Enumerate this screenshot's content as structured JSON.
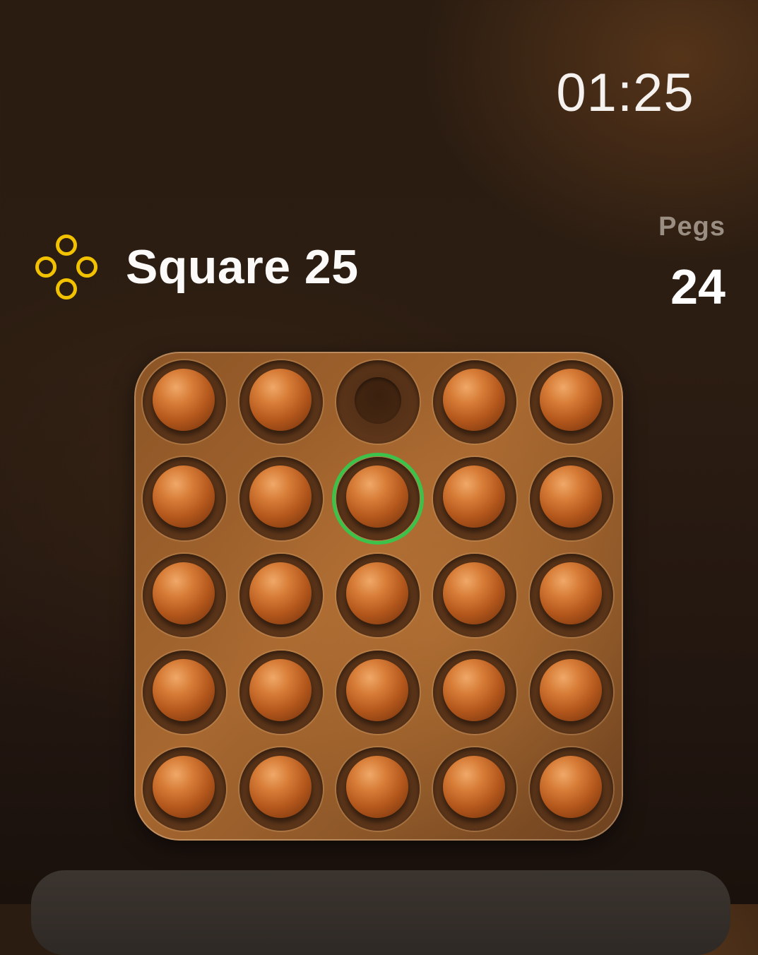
{
  "status": {
    "time": "01:25"
  },
  "header": {
    "logo_icon": "four-circles-icon",
    "title": "Square 25",
    "accent_color": "#f2c200"
  },
  "stats": {
    "pegs_label": "Pegs",
    "pegs_count": "24"
  },
  "board": {
    "rows": 5,
    "cols": 5,
    "selected_color": "#3cc14a",
    "cells": [
      [
        {
          "peg": true
        },
        {
          "peg": true
        },
        {
          "peg": false
        },
        {
          "peg": true
        },
        {
          "peg": true
        }
      ],
      [
        {
          "peg": true
        },
        {
          "peg": true
        },
        {
          "peg": true,
          "selected": true
        },
        {
          "peg": true
        },
        {
          "peg": true
        }
      ],
      [
        {
          "peg": true
        },
        {
          "peg": true
        },
        {
          "peg": true
        },
        {
          "peg": true
        },
        {
          "peg": true
        }
      ],
      [
        {
          "peg": true
        },
        {
          "peg": true
        },
        {
          "peg": true
        },
        {
          "peg": true
        },
        {
          "peg": true
        }
      ],
      [
        {
          "peg": true
        },
        {
          "peg": true
        },
        {
          "peg": true
        },
        {
          "peg": true
        },
        {
          "peg": true
        }
      ]
    ]
  }
}
